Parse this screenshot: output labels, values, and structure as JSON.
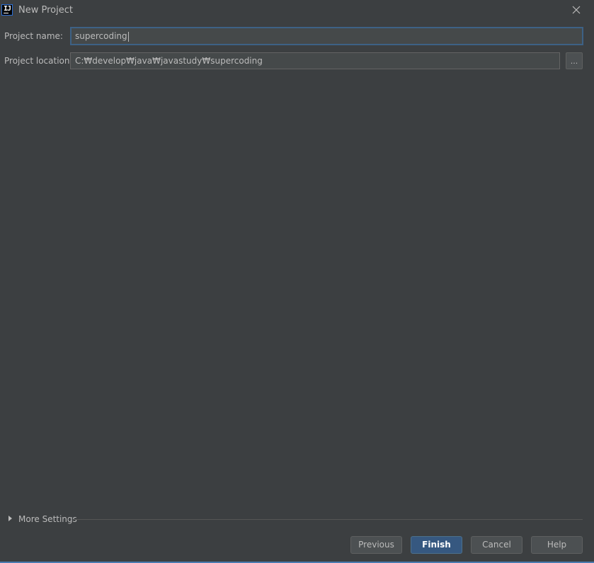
{
  "window": {
    "title": "New Project",
    "app_icon": "intellij-idea-icon",
    "close_icon": "close-icon"
  },
  "form": {
    "project_name_label": "Project name:",
    "project_name_value": "supercoding",
    "project_location_label": "Project location:",
    "project_location_value": "C:₩develop₩java₩javastudy₩supercoding",
    "browse_label": "..."
  },
  "more_settings": {
    "label": "More Settings",
    "expanded": false
  },
  "footer": {
    "previous_label": "Previous",
    "finish_label": "Finish",
    "cancel_label": "Cancel",
    "help_label": "Help"
  },
  "colors": {
    "background": "#3c3f41",
    "field_background": "#45494a",
    "focus_border": "#3d6185",
    "primary_button": "#365880",
    "text": "#bbbbbb"
  }
}
